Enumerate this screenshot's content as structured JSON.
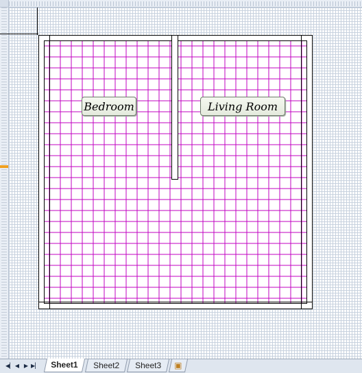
{
  "sheet_tabs": [
    {
      "label": "Sheet1",
      "active": true
    },
    {
      "label": "Sheet2",
      "active": false
    },
    {
      "label": "Sheet3",
      "active": false
    }
  ],
  "labels": {
    "bedroom": "Bedroom",
    "living_room": "Living Room"
  },
  "colors": {
    "grid_line": "#c7d1de",
    "floor_grid": "#c000c0",
    "wall": "#000000",
    "label_bg": "#eef2ea"
  },
  "icons": {
    "nav_first": "first-sheet-icon",
    "nav_prev": "previous-sheet-icon",
    "nav_next": "next-sheet-icon",
    "nav_last": "last-sheet-icon",
    "insert_sheet": "insert-worksheet-icon"
  }
}
